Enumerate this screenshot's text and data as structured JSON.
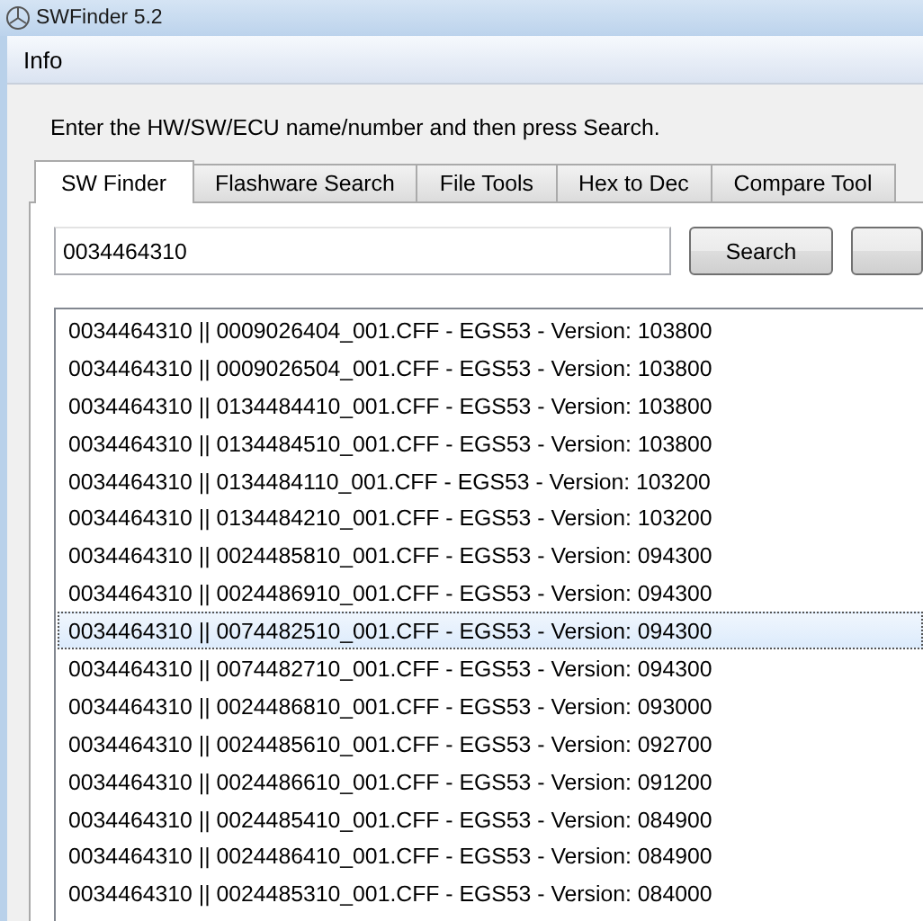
{
  "window": {
    "title": "SWFinder 5.2"
  },
  "menu": [
    {
      "label": "Info"
    }
  ],
  "instruction": "Enter the HW/SW/ECU name/number and then press Search.",
  "tabs": [
    {
      "label": "SW Finder",
      "selected": true
    },
    {
      "label": "Flashware Search",
      "selected": false
    },
    {
      "label": "File Tools",
      "selected": false
    },
    {
      "label": "Hex to Dec",
      "selected": false
    },
    {
      "label": "Compare Tool",
      "selected": false
    }
  ],
  "search": {
    "value": "0034464310",
    "button": "Search"
  },
  "results": [
    {
      "text": "0034464310 || 0009026404_001.CFF - EGS53 - Version: 103800",
      "selected": false
    },
    {
      "text": "0034464310 || 0009026504_001.CFF - EGS53 - Version: 103800",
      "selected": false
    },
    {
      "text": "0034464310 || 0134484410_001.CFF - EGS53 - Version: 103800",
      "selected": false
    },
    {
      "text": "0034464310 || 0134484510_001.CFF - EGS53 - Version: 103800",
      "selected": false
    },
    {
      "text": "0034464310 || 0134484110_001.CFF - EGS53 - Version: 103200",
      "selected": false
    },
    {
      "text": "0034464310 || 0134484210_001.CFF - EGS53 - Version: 103200",
      "selected": false
    },
    {
      "text": "0034464310 || 0024485810_001.CFF - EGS53 - Version: 094300",
      "selected": false
    },
    {
      "text": "0034464310 || 0024486910_001.CFF - EGS53 - Version: 094300",
      "selected": false
    },
    {
      "text": "0034464310 || 0074482510_001.CFF - EGS53 - Version: 094300",
      "selected": true
    },
    {
      "text": "0034464310 || 0074482710_001.CFF - EGS53 - Version: 094300",
      "selected": false
    },
    {
      "text": "0034464310 || 0024486810_001.CFF - EGS53 - Version: 093000",
      "selected": false
    },
    {
      "text": "0034464310 || 0024485610_001.CFF - EGS53 - Version: 092700",
      "selected": false
    },
    {
      "text": "0034464310 || 0024486610_001.CFF - EGS53 - Version: 091200",
      "selected": false
    },
    {
      "text": "0034464310 || 0024485410_001.CFF - EGS53 - Version: 084900",
      "selected": false
    },
    {
      "text": "0034464310 || 0024486410_001.CFF - EGS53 - Version: 084900",
      "selected": false
    },
    {
      "text": "0034464310 || 0024485310_001.CFF - EGS53 - Version: 084000",
      "selected": false
    }
  ]
}
